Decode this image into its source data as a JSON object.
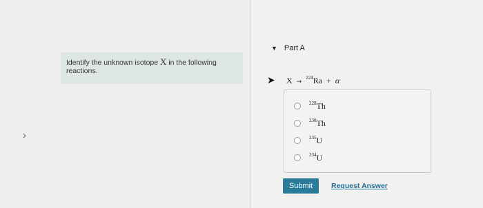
{
  "left": {
    "nav_arrow": "›",
    "instruction": {
      "prefix": "Identify the unknown isotope ",
      "symbol": "X",
      "suffix": " in the following reactions."
    }
  },
  "part": {
    "caret": "▼",
    "title": "Part A"
  },
  "reaction": {
    "unknown": "X",
    "arrow": "→",
    "product_mass": "224",
    "product_element": "Ra",
    "plus": "+",
    "particle": "α"
  },
  "options": [
    {
      "mass": "228",
      "element": "Th"
    },
    {
      "mass": "230",
      "element": "Th"
    },
    {
      "mass": "235",
      "element": "U"
    },
    {
      "mass": "234",
      "element": "U"
    }
  ],
  "actions": {
    "submit_label": "Submit",
    "request_label": "Request Answer"
  },
  "colors": {
    "accent": "#2a7a99",
    "instruction_bg": "#dde6e0"
  }
}
